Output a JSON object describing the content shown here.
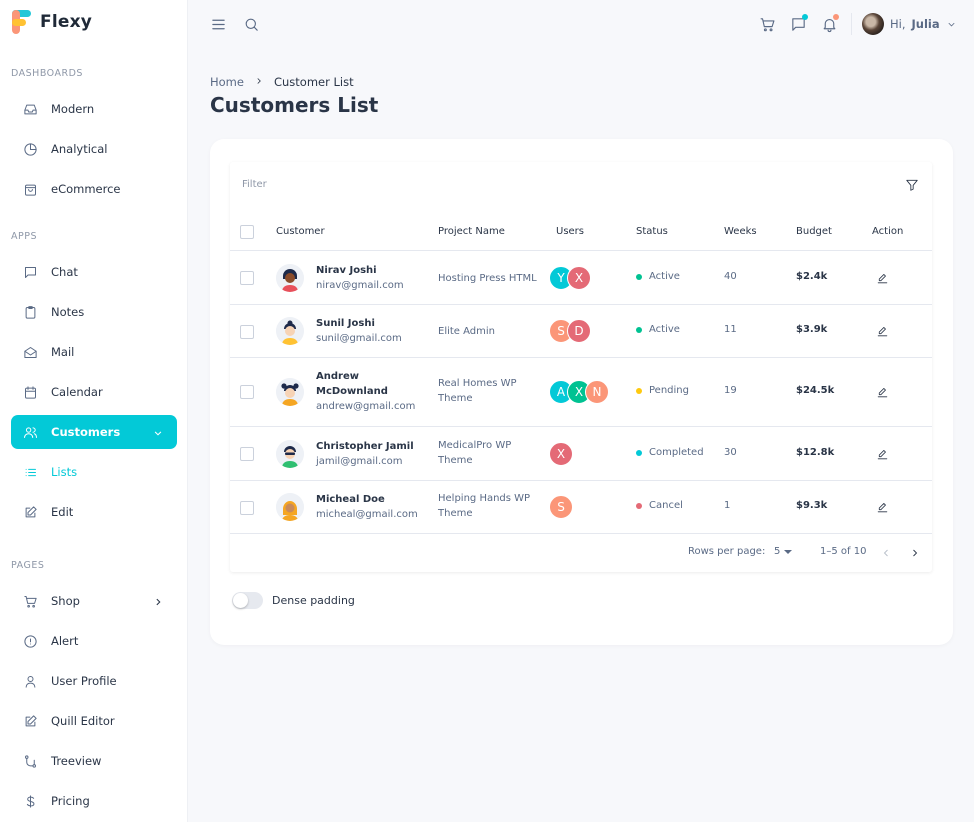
{
  "app": {
    "name": "Flexy"
  },
  "sidebar": {
    "sections": {
      "dashboards": "DASHBOARDS",
      "apps": "APPS",
      "pages": "PAGES"
    },
    "items": {
      "modern": "Modern",
      "analytical": "Analytical",
      "ecommerce": "eCommerce",
      "chat": "Chat",
      "notes": "Notes",
      "mail": "Mail",
      "calendar": "Calendar",
      "customers": "Customers",
      "lists": "Lists",
      "edit": "Edit",
      "shop": "Shop",
      "alert": "Alert",
      "user_profile": "User Profile",
      "quill_editor": "Quill Editor",
      "treeview": "Treeview",
      "pricing": "Pricing"
    }
  },
  "header": {
    "greeting": "Hi,",
    "user_name": "Julia",
    "message_dot_color": "#03c9d7",
    "notification_dot_color": "#fb9678"
  },
  "breadcrumb": {
    "home": "Home",
    "current": "Customer List"
  },
  "page": {
    "title": "Customers List"
  },
  "table": {
    "filter_label": "Filter",
    "columns": {
      "customer": "Customer",
      "project": "Project Name",
      "users": "Users",
      "status": "Status",
      "weeks": "Weeks",
      "budget": "Budget",
      "action": "Action"
    },
    "rows": [
      {
        "name_line1": "Nirav Joshi",
        "name_line2": "",
        "email": "nirav@gmail.com",
        "project_line1": "Hosting Press HTML",
        "project_line2": "",
        "users": [
          {
            "letter": "Y",
            "color": "#03c9d7"
          },
          {
            "letter": "X",
            "color": "#e46a76"
          }
        ],
        "status": "Active",
        "status_color": "#00c292",
        "weeks": "40",
        "budget": "$2.4k"
      },
      {
        "name_line1": "Sunil Joshi",
        "name_line2": "",
        "email": "sunil@gmail.com",
        "project_line1": "Elite Admin",
        "project_line2": "",
        "users": [
          {
            "letter": "S",
            "color": "#fb9678"
          },
          {
            "letter": "D",
            "color": "#e46a76"
          }
        ],
        "status": "Active",
        "status_color": "#00c292",
        "weeks": "11",
        "budget": "$3.9k"
      },
      {
        "name_line1": "Andrew",
        "name_line2": "McDownland",
        "email": "andrew@gmail.com",
        "project_line1": "Real Homes WP",
        "project_line2": "Theme",
        "users": [
          {
            "letter": "A",
            "color": "#03c9d7"
          },
          {
            "letter": "X",
            "color": "#00c292"
          },
          {
            "letter": "N",
            "color": "#fb9678"
          }
        ],
        "status": "Pending",
        "status_color": "#fec90f",
        "weeks": "19",
        "budget": "$24.5k"
      },
      {
        "name_line1": "Christopher Jamil",
        "name_line2": "",
        "email": "jamil@gmail.com",
        "project_line1": "MedicalPro WP",
        "project_line2": "Theme",
        "users": [
          {
            "letter": "X",
            "color": "#e46a76"
          }
        ],
        "status": "Completed",
        "status_color": "#03c9d7",
        "weeks": "30",
        "budget": "$12.8k"
      },
      {
        "name_line1": "Micheal Doe",
        "name_line2": "",
        "email": "micheal@gmail.com",
        "project_line1": "Helping Hands WP",
        "project_line2": "Theme",
        "users": [
          {
            "letter": "S",
            "color": "#fb9678"
          }
        ],
        "status": "Cancel",
        "status_color": "#e46a76",
        "weeks": "1",
        "budget": "$9.3k"
      }
    ],
    "pagination": {
      "rows_per_page_label": "Rows per page:",
      "rows_per_page": "5",
      "range": "1–5 of 10"
    }
  },
  "dense_padding_label": "Dense padding"
}
